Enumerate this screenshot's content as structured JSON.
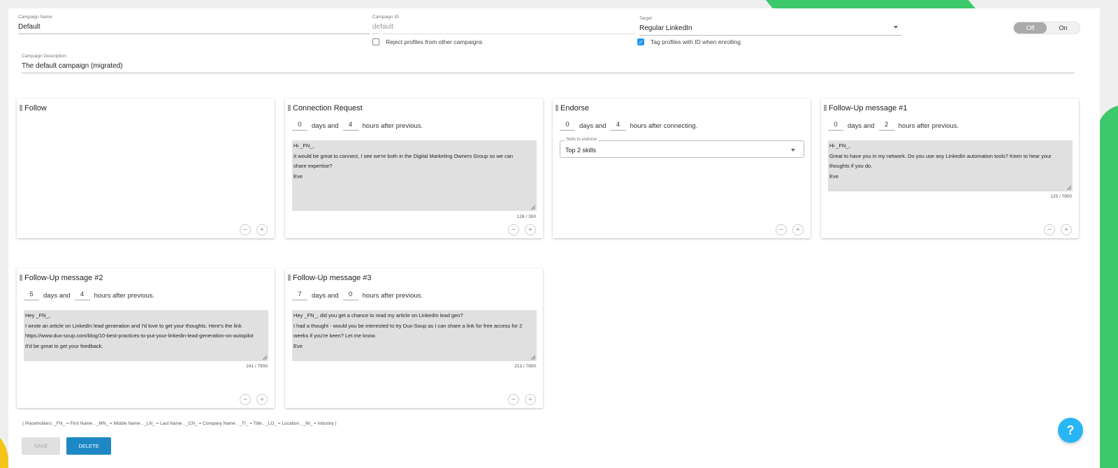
{
  "header": {
    "campaign_name": {
      "label": "Campaign Name",
      "value": "Default"
    },
    "campaign_id": {
      "label": "Campaign ID",
      "value": "default"
    },
    "target": {
      "label": "Target",
      "value": "Regular LinkedIn"
    },
    "toggle": {
      "off": "Off",
      "on": "On",
      "selected": "Off"
    },
    "reject_profiles": {
      "label": "Reject profiles from other campaigns",
      "checked": false
    },
    "tag_profiles": {
      "label": "Tag profiles with ID when enrolling",
      "checked": true
    },
    "description": {
      "label": "Campaign Description",
      "value": "The default campaign (migrated)"
    }
  },
  "cards": [
    {
      "title": "Follow"
    },
    {
      "title": "Connection Request",
      "days": "0",
      "days_text": "days and",
      "hours": "4",
      "hours_text": "hours after previous.",
      "message_lines": [
        "Hi _FN_,",
        "It would be great to connect, I see we're both in the Digital Marketing Owners Group so we can",
        "share expertise?",
        "Eve"
      ],
      "counter": "126 / 300"
    },
    {
      "title": "Endorse",
      "days": "0",
      "days_text": "days and",
      "hours": "4",
      "hours_text": "hours after connecting.",
      "skills_label": "Skills to endorse",
      "skills_value": "Top 2 skills"
    },
    {
      "title": "Follow-Up message #1",
      "days": "0",
      "days_text": "days and",
      "hours": "2",
      "hours_text": "hours after previous.",
      "message_lines": [
        "Hi _FN_,",
        "Great to have you in my network. Do you use any LinkedIn automation tools? Keen to hear your",
        "thoughts if you do.",
        "Eve"
      ],
      "counter": "125 / 7900"
    },
    {
      "title": "Follow-Up message #2",
      "days": "5",
      "days_text": "days and",
      "hours": "4",
      "hours_text": "hours after previous.",
      "message_lines": [
        "Hey _FN_,",
        "I wrote an article on LinkedIn lead generation and I'd love to get your thoughts. Here's the link",
        "https://www.dux-soup.com/blog/10-best-practices-to-put-your-linkedin-lead-generation-on-autopilot",
        "It'd be great to get your feedback."
      ],
      "counter": "241 / 7900"
    },
    {
      "title": "Follow-Up message #3",
      "days": "7",
      "days_text": "days and",
      "hours": "0",
      "hours_text": "hours after previous.",
      "message_lines": [
        "Hey _FN_, did you get a chance to read my article on LinkedIn lead gen?",
        "I had a thought - would you be interested to try Dux-Soup as I can share a link for free access for 2",
        "weeks if you're keen? Let me know.",
        "Eve"
      ],
      "counter": "213 / 7900"
    }
  ],
  "buttons": {
    "minus": "−",
    "plus": "+",
    "save": "SAVE",
    "delete": "DELETE",
    "help": "?"
  },
  "placeholders_text": "( Placeholders: _FN_ = First Name , _MN_ = Middle Name , _LN_ = Last Name , _CN_ = Company Name , _TI_ = Title , _LO_ = Location , _IN_ = Industry )",
  "colors": {
    "primary": "#1e88c4",
    "check": "#2196f3",
    "help": "#29b6f6",
    "accent_green": "#3cc96c",
    "accent_yellow": "#f5c518"
  }
}
